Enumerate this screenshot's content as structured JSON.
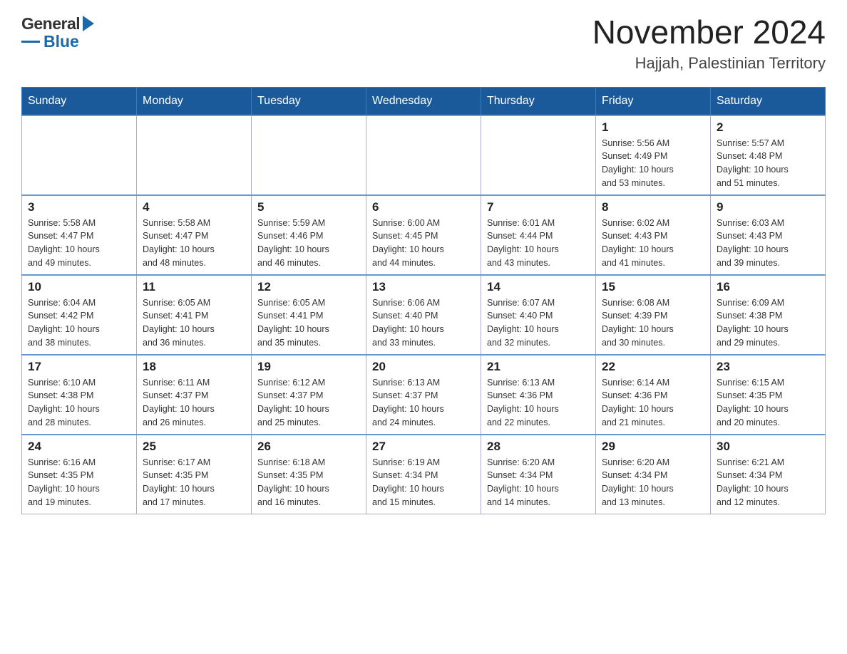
{
  "header": {
    "logo": {
      "general_text": "General",
      "blue_text": "Blue"
    },
    "title": "November 2024",
    "subtitle": "Hajjah, Palestinian Territory"
  },
  "calendar": {
    "days_of_week": [
      "Sunday",
      "Monday",
      "Tuesday",
      "Wednesday",
      "Thursday",
      "Friday",
      "Saturday"
    ],
    "weeks": [
      [
        {
          "day": "",
          "info": ""
        },
        {
          "day": "",
          "info": ""
        },
        {
          "day": "",
          "info": ""
        },
        {
          "day": "",
          "info": ""
        },
        {
          "day": "",
          "info": ""
        },
        {
          "day": "1",
          "info": "Sunrise: 5:56 AM\nSunset: 4:49 PM\nDaylight: 10 hours\nand 53 minutes."
        },
        {
          "day": "2",
          "info": "Sunrise: 5:57 AM\nSunset: 4:48 PM\nDaylight: 10 hours\nand 51 minutes."
        }
      ],
      [
        {
          "day": "3",
          "info": "Sunrise: 5:58 AM\nSunset: 4:47 PM\nDaylight: 10 hours\nand 49 minutes."
        },
        {
          "day": "4",
          "info": "Sunrise: 5:58 AM\nSunset: 4:47 PM\nDaylight: 10 hours\nand 48 minutes."
        },
        {
          "day": "5",
          "info": "Sunrise: 5:59 AM\nSunset: 4:46 PM\nDaylight: 10 hours\nand 46 minutes."
        },
        {
          "day": "6",
          "info": "Sunrise: 6:00 AM\nSunset: 4:45 PM\nDaylight: 10 hours\nand 44 minutes."
        },
        {
          "day": "7",
          "info": "Sunrise: 6:01 AM\nSunset: 4:44 PM\nDaylight: 10 hours\nand 43 minutes."
        },
        {
          "day": "8",
          "info": "Sunrise: 6:02 AM\nSunset: 4:43 PM\nDaylight: 10 hours\nand 41 minutes."
        },
        {
          "day": "9",
          "info": "Sunrise: 6:03 AM\nSunset: 4:43 PM\nDaylight: 10 hours\nand 39 minutes."
        }
      ],
      [
        {
          "day": "10",
          "info": "Sunrise: 6:04 AM\nSunset: 4:42 PM\nDaylight: 10 hours\nand 38 minutes."
        },
        {
          "day": "11",
          "info": "Sunrise: 6:05 AM\nSunset: 4:41 PM\nDaylight: 10 hours\nand 36 minutes."
        },
        {
          "day": "12",
          "info": "Sunrise: 6:05 AM\nSunset: 4:41 PM\nDaylight: 10 hours\nand 35 minutes."
        },
        {
          "day": "13",
          "info": "Sunrise: 6:06 AM\nSunset: 4:40 PM\nDaylight: 10 hours\nand 33 minutes."
        },
        {
          "day": "14",
          "info": "Sunrise: 6:07 AM\nSunset: 4:40 PM\nDaylight: 10 hours\nand 32 minutes."
        },
        {
          "day": "15",
          "info": "Sunrise: 6:08 AM\nSunset: 4:39 PM\nDaylight: 10 hours\nand 30 minutes."
        },
        {
          "day": "16",
          "info": "Sunrise: 6:09 AM\nSunset: 4:38 PM\nDaylight: 10 hours\nand 29 minutes."
        }
      ],
      [
        {
          "day": "17",
          "info": "Sunrise: 6:10 AM\nSunset: 4:38 PM\nDaylight: 10 hours\nand 28 minutes."
        },
        {
          "day": "18",
          "info": "Sunrise: 6:11 AM\nSunset: 4:37 PM\nDaylight: 10 hours\nand 26 minutes."
        },
        {
          "day": "19",
          "info": "Sunrise: 6:12 AM\nSunset: 4:37 PM\nDaylight: 10 hours\nand 25 minutes."
        },
        {
          "day": "20",
          "info": "Sunrise: 6:13 AM\nSunset: 4:37 PM\nDaylight: 10 hours\nand 24 minutes."
        },
        {
          "day": "21",
          "info": "Sunrise: 6:13 AM\nSunset: 4:36 PM\nDaylight: 10 hours\nand 22 minutes."
        },
        {
          "day": "22",
          "info": "Sunrise: 6:14 AM\nSunset: 4:36 PM\nDaylight: 10 hours\nand 21 minutes."
        },
        {
          "day": "23",
          "info": "Sunrise: 6:15 AM\nSunset: 4:35 PM\nDaylight: 10 hours\nand 20 minutes."
        }
      ],
      [
        {
          "day": "24",
          "info": "Sunrise: 6:16 AM\nSunset: 4:35 PM\nDaylight: 10 hours\nand 19 minutes."
        },
        {
          "day": "25",
          "info": "Sunrise: 6:17 AM\nSunset: 4:35 PM\nDaylight: 10 hours\nand 17 minutes."
        },
        {
          "day": "26",
          "info": "Sunrise: 6:18 AM\nSunset: 4:35 PM\nDaylight: 10 hours\nand 16 minutes."
        },
        {
          "day": "27",
          "info": "Sunrise: 6:19 AM\nSunset: 4:34 PM\nDaylight: 10 hours\nand 15 minutes."
        },
        {
          "day": "28",
          "info": "Sunrise: 6:20 AM\nSunset: 4:34 PM\nDaylight: 10 hours\nand 14 minutes."
        },
        {
          "day": "29",
          "info": "Sunrise: 6:20 AM\nSunset: 4:34 PM\nDaylight: 10 hours\nand 13 minutes."
        },
        {
          "day": "30",
          "info": "Sunrise: 6:21 AM\nSunset: 4:34 PM\nDaylight: 10 hours\nand 12 minutes."
        }
      ]
    ]
  }
}
